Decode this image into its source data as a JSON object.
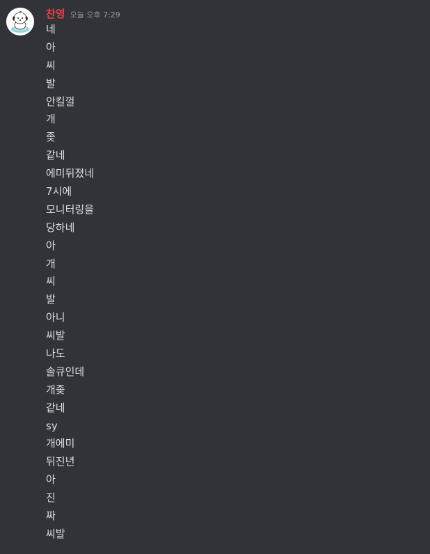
{
  "message": {
    "author": "찬영",
    "timestamp": "오늘 오후 7:29",
    "author_color": "#f23f43",
    "avatar_icon": "puppy-avatar-icon",
    "lines": [
      "네",
      "아",
      "씨",
      "발",
      "안킬껄",
      "개",
      "좆",
      "같네",
      "에미뒤졌네",
      "7시에",
      "모니터링을",
      "당하네",
      "아",
      "개",
      "씨",
      "발",
      "아니",
      "씨발",
      "나도",
      "솔큐인데",
      "개좆",
      "같네",
      "sy",
      "개에미",
      "뒤진년",
      "아",
      "진",
      "짜",
      "씨발"
    ]
  },
  "theme": {
    "background": "#313338",
    "text": "#dbdee1",
    "muted": "#949ba4"
  }
}
